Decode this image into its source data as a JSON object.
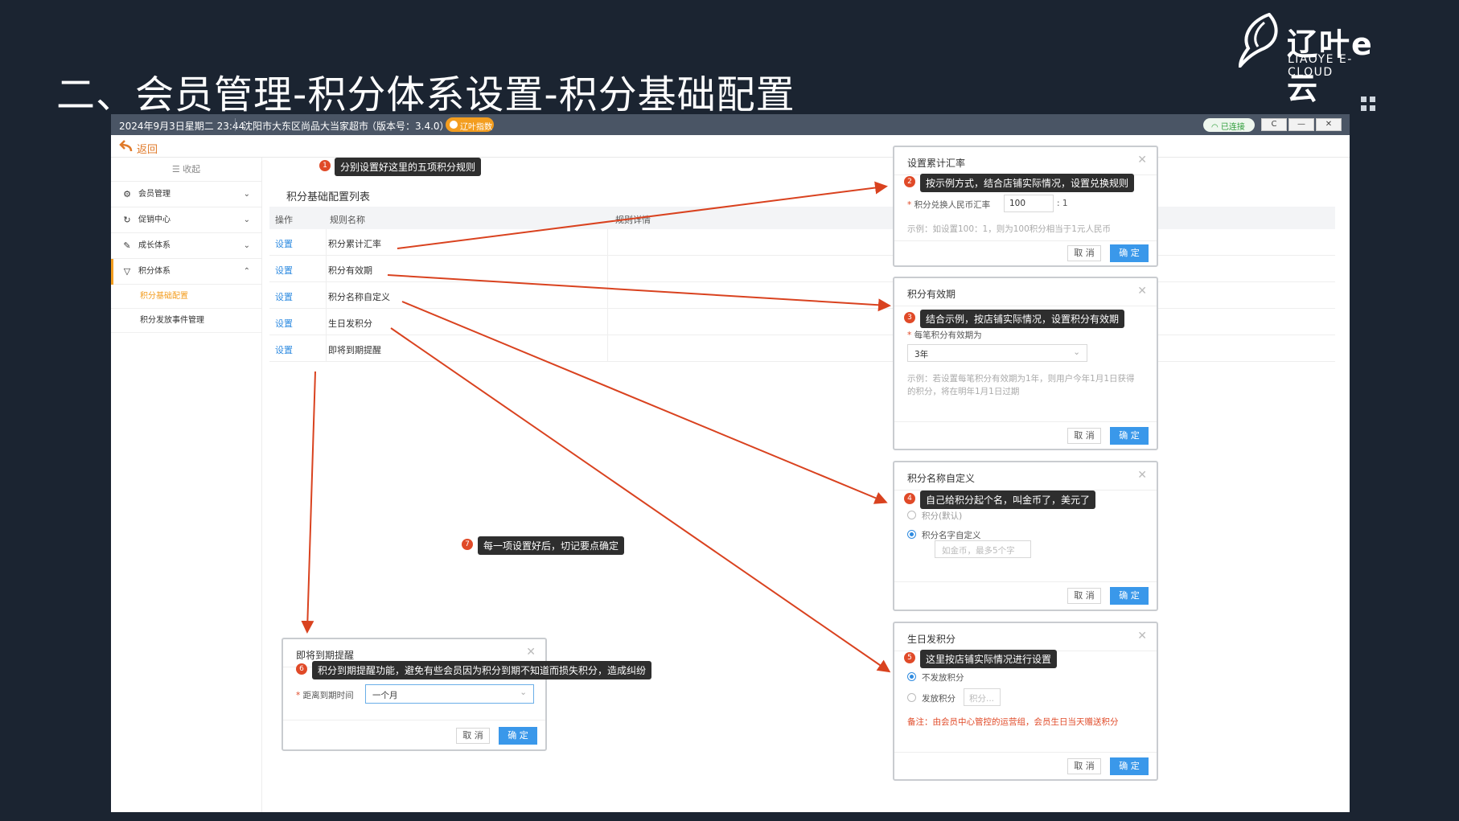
{
  "slide": {
    "title": "二、会员管理-积分体系设置-积分基础配置",
    "logo_cn": "辽叶e云",
    "logo_en": "LIAOYE E-CLOUD"
  },
  "titlebar": {
    "datetime": "2024年9月3日星期二 23:44",
    "store": "沈阳市大东区尚品大当家超市",
    "version": "（版本号：3.4.0）",
    "badge": "辽叶指数",
    "connection": "已连接",
    "buttons": [
      "C",
      "—",
      "✕"
    ]
  },
  "back_label": "返回",
  "sidebar": {
    "collapse_label": "☰ 收起",
    "items": [
      {
        "label": "会员管理",
        "icon": "gear-icon",
        "glyph": "⚙",
        "chevron": "⌄"
      },
      {
        "label": "促销中心",
        "icon": "refresh-icon",
        "glyph": "↻",
        "chevron": "⌄"
      },
      {
        "label": "成长体系",
        "icon": "growth-icon",
        "glyph": "✎",
        "chevron": "⌄"
      },
      {
        "label": "积分体系",
        "icon": "filter-icon",
        "glyph": "▽",
        "chevron": "⌃"
      }
    ],
    "sub_items": [
      "积分基础配置",
      "积分发放事件管理"
    ]
  },
  "list": {
    "title": "积分基础配置列表",
    "headers": [
      "操作",
      "规则名称",
      "规则详情"
    ],
    "rows": [
      {
        "op": "设置",
        "name": "积分累计汇率"
      },
      {
        "op": "设置",
        "name": "积分有效期"
      },
      {
        "op": "设置",
        "name": "积分名称自定义"
      },
      {
        "op": "设置",
        "name": "生日发积分"
      },
      {
        "op": "设置",
        "name": "即将到期提醒"
      }
    ]
  },
  "tips": [
    {
      "n": "1",
      "text": "分别设置好这里的五项积分规则"
    },
    {
      "n": "2",
      "text": "按示例方式，结合店铺实际情况，设置兑换规则"
    },
    {
      "n": "3",
      "text": "结合示例，按店铺实际情况，设置积分有效期"
    },
    {
      "n": "4",
      "text": "自己给积分起个名，叫金币了，美元了"
    },
    {
      "n": "5",
      "text": "这里按店铺实际情况进行设置"
    },
    {
      "n": "6",
      "text": "积分到期提醒功能，避免有些会员因为积分到期不知道而损失积分，造成纠纷"
    },
    {
      "n": "7",
      "text": "每一项设置好后，切记要点确定"
    }
  ],
  "buttons": {
    "cancel": "取 消",
    "ok": "确 定"
  },
  "dialog_rate": {
    "title": "设置累计汇率",
    "label": "积分兑换人民币汇率",
    "value": "100",
    "suffix": ": 1",
    "hint": "示例：如设置100：1，则为100积分相当于1元人民币"
  },
  "dialog_validity": {
    "title": "积分有效期",
    "label": "每笔积分有效期为",
    "value": "3年",
    "hint1": "示例：若设置每笔积分有效期为1年，则用户今年1月1日获得",
    "hint2": "的积分，将在明年1月1日过期"
  },
  "dialog_name": {
    "title": "积分名称自定义",
    "opt1": "积分(默认)",
    "opt2": "积分名字自定义",
    "placeholder": "如金币，最多5个字"
  },
  "dialog_birthday": {
    "title": "生日发积分",
    "opt1": "不发放积分",
    "opt2": "发放积分",
    "placeholder": "积分...",
    "note": "备注：由会员中心管控的运营组，会员生日当天赠送积分"
  },
  "dialog_expire": {
    "title": "即将到期提醒",
    "label": "距离到期时间",
    "value": "一个月"
  },
  "colors": {
    "accent": "#f39d1f",
    "arrow": "#d9421f",
    "primary": "#3a98ea",
    "bg": "#1b2431"
  }
}
